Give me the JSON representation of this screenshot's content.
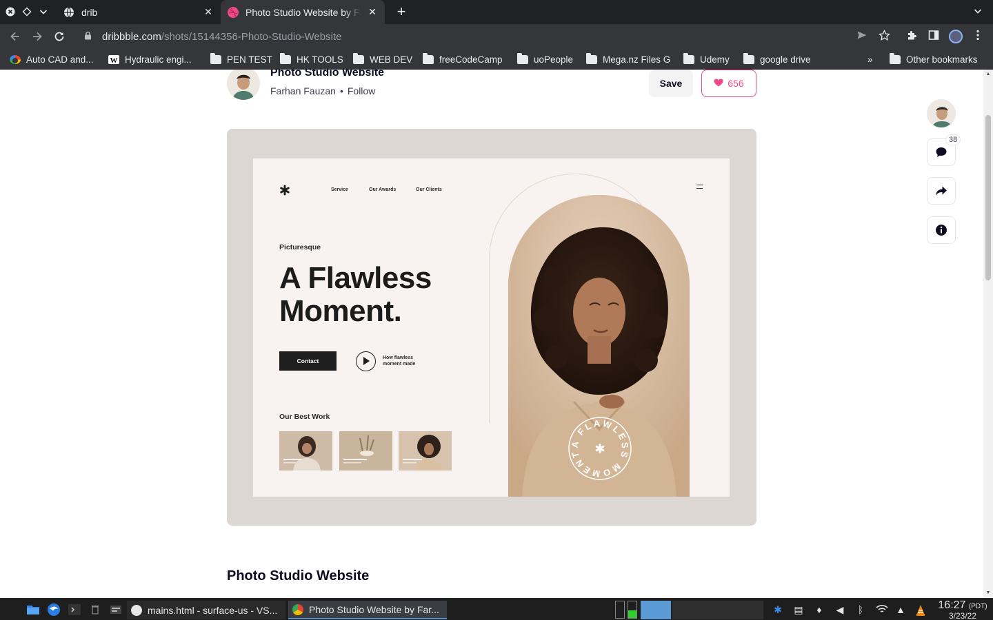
{
  "browser": {
    "tabs": [
      {
        "title": "drib",
        "active": false
      },
      {
        "title": "Photo Studio Website by Fa",
        "active": true
      }
    ],
    "url_host": "dribbble.com",
    "url_path": "/shots/15144356-Photo-Studio-Website",
    "bookmarks": [
      {
        "label": "Auto CAD and...",
        "icon": "google-icon"
      },
      {
        "label": "Hydraulic engi...",
        "icon": "wikipedia-icon"
      },
      {
        "label": "PEN TEST",
        "icon": "folder-icon"
      },
      {
        "label": "HK TOOLS",
        "icon": "folder-icon"
      },
      {
        "label": "WEB DEV",
        "icon": "folder-icon"
      },
      {
        "label": "freeCodeCamp",
        "icon": "folder-icon"
      },
      {
        "label": "uoPeople",
        "icon": "folder-icon"
      },
      {
        "label": "Mega.nz Files G",
        "icon": "folder-icon"
      },
      {
        "label": "Udemy",
        "icon": "folder-icon"
      },
      {
        "label": "google drive",
        "icon": "folder-icon"
      }
    ],
    "overflow_label": "»",
    "other_bookmarks": "Other bookmarks"
  },
  "shot": {
    "title": "Photo Studio Website",
    "author": "Farhan Fauzan",
    "follow_label": "Follow",
    "save_label": "Save",
    "likes": "656",
    "comments_count": "38",
    "section_title": "Photo Studio Website"
  },
  "mockup": {
    "nav": [
      "Service",
      "Our Awards",
      "Our Clients"
    ],
    "eyebrow": "Picturesque",
    "headline_line1": "A Flawless",
    "headline_line2": "Moment.",
    "contact_label": "Contact",
    "play_label": "How flawless moment made",
    "section_label": "Our Best Work",
    "badge_text": "A FLAWLESS MOMENT"
  },
  "taskbar": {
    "tasks": [
      {
        "label": "mains.html - surface-us - VS..."
      },
      {
        "label": "Photo Studio Website by Far..."
      }
    ],
    "time": "16:27",
    "timezone": "(PDT)",
    "date": "3/23/22"
  },
  "colors": {
    "dribbble_pink": "#ea4c89",
    "chrome_dark": "#202124",
    "chrome_toolbar": "#35363a",
    "shot_bg": "#dcd7d2",
    "mock_bg": "#f8f3f1"
  }
}
